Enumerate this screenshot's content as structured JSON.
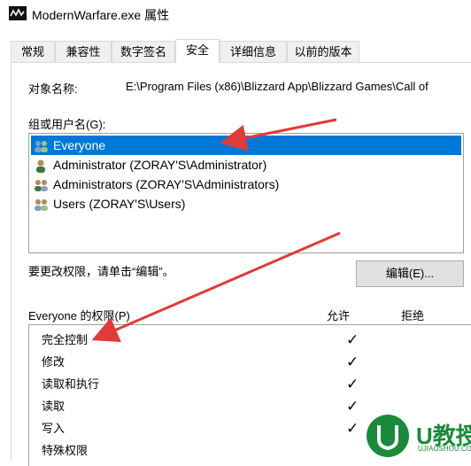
{
  "window": {
    "title": "ModernWarfare.exe 属性"
  },
  "tabs": [
    {
      "label": "常规"
    },
    {
      "label": "兼容性"
    },
    {
      "label": "数字签名"
    },
    {
      "label": "安全"
    },
    {
      "label": "详细信息"
    },
    {
      "label": "以前的版本"
    }
  ],
  "active_tab": "安全",
  "object": {
    "label": "对象名称:",
    "value": "E:\\Program Files (x86)\\Blizzard App\\Blizzard Games\\Call of"
  },
  "group_list": {
    "label": "组或用户名(G):",
    "items": [
      {
        "name": "Everyone",
        "selected": true,
        "icon": "users-group-icon"
      },
      {
        "name": "Administrator (ZORAY'S\\Administrator)",
        "selected": false,
        "icon": "user-icon"
      },
      {
        "name": "Administrators (ZORAY'S\\Administrators)",
        "selected": false,
        "icon": "users-group-icon"
      },
      {
        "name": "Users (ZORAY'S\\Users)",
        "selected": false,
        "icon": "users-group-icon"
      }
    ]
  },
  "edit_hint": "要更改权限，请单击“编辑”。",
  "edit_button": "编辑(E)...",
  "permissions": {
    "title": "Everyone 的权限(P)",
    "allow_header": "允许",
    "deny_header": "拒绝",
    "rows": [
      {
        "name": "完全控制",
        "allow": "✓"
      },
      {
        "name": "修改",
        "allow": "✓"
      },
      {
        "name": "读取和执行",
        "allow": "✓"
      },
      {
        "name": "读取",
        "allow": "✓"
      },
      {
        "name": "写入",
        "allow": "✓"
      },
      {
        "name": "特殊权限",
        "allow": ""
      }
    ]
  },
  "watermark": {
    "brand": "U教授",
    "url": "UJIAOSHOU.COM"
  },
  "colors": {
    "selection": "#0078d7",
    "arrow": "#e03a3a",
    "brand": "#1a8a3a"
  }
}
